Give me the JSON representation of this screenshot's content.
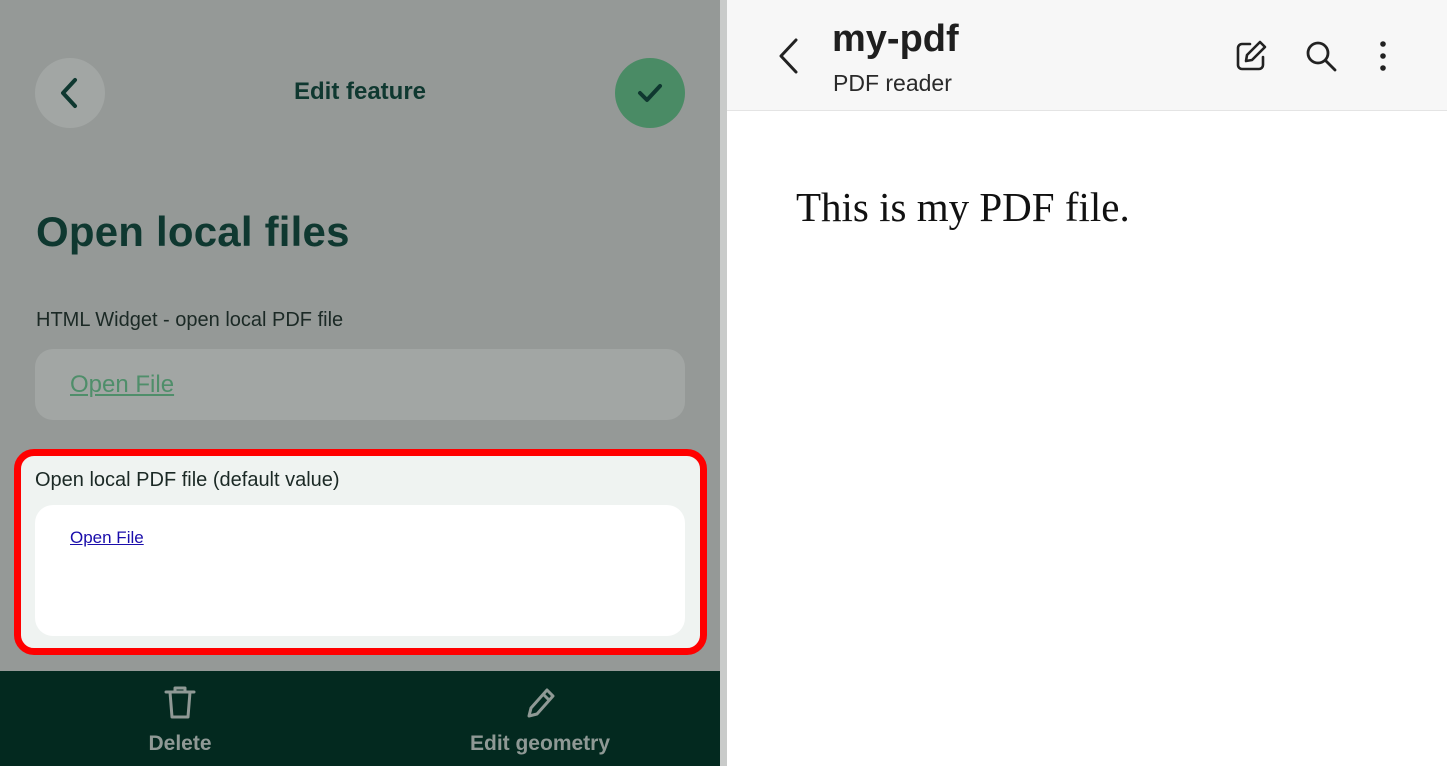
{
  "editor": {
    "header_title": "Edit feature",
    "page_title": "Open local files",
    "html_widget": {
      "label": "HTML Widget - open local PDF file",
      "link_text": "Open File"
    },
    "default_field": {
      "label": "Open local PDF file (default value)",
      "link_text": "Open File"
    },
    "toolbar": {
      "delete_label": "Delete",
      "edit_geometry_label": "Edit geometry"
    },
    "icons": {
      "back": "chevron-left-icon",
      "confirm": "check-icon",
      "delete": "trash-icon",
      "edit_geometry": "pencil-icon"
    },
    "colors": {
      "accent_green": "#4a8b65",
      "toolbar_bg": "#03291f",
      "highlight": "#ff0000"
    }
  },
  "reader": {
    "title": "my-pdf",
    "subtitle": "PDF reader",
    "document_text": "This is my PDF file.",
    "icons": {
      "back": "chevron-left-icon",
      "edit": "edit-icon",
      "search": "search-icon",
      "menu": "more-vert-icon"
    }
  }
}
